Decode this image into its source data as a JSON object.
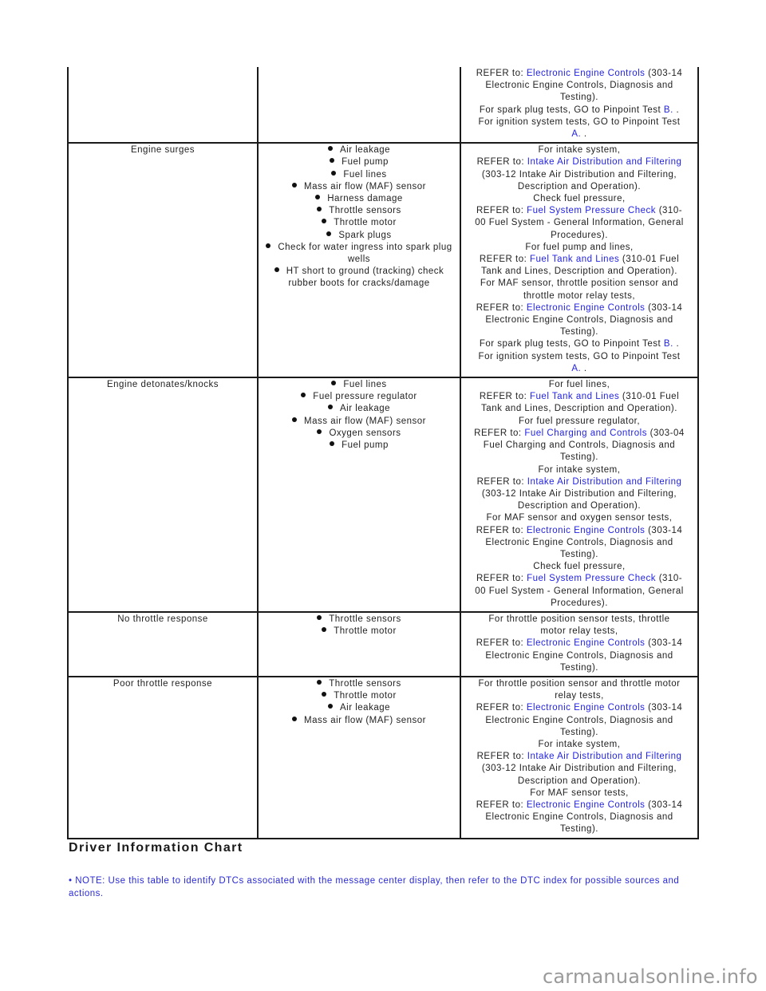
{
  "table": {
    "rows": [
      {
        "symptom": "",
        "causes": [],
        "actions": [
          {
            "segments": [
              {
                "t": "REFER to: "
              },
              {
                "t": "Electronic Engine Controls",
                "link": true
              },
              {
                "t": " (303-14"
              }
            ]
          },
          {
            "segments": [
              {
                "t": "Electronic Engine Controls, Diagnosis and"
              }
            ]
          },
          {
            "segments": [
              {
                "t": "Testing)."
              }
            ]
          },
          {
            "segments": [
              {
                "t": "For spark plug tests, GO to Pinpoint Test "
              },
              {
                "t": "B.",
                "link": true
              },
              {
                "t": " ."
              }
            ]
          },
          {
            "segments": [
              {
                "t": "For ignition system tests, GO to Pinpoint Test"
              }
            ]
          },
          {
            "segments": [
              {
                "t": "A.",
                "link": true
              },
              {
                "t": " ."
              }
            ]
          }
        ]
      },
      {
        "symptom": "Engine surges",
        "causes": [
          "Air leakage",
          "Fuel pump",
          "Fuel lines",
          "Mass air flow (MAF) sensor",
          "Harness damage",
          "Throttle sensors",
          "Throttle motor",
          "Spark plugs",
          "Check for water ingress into spark plug wells",
          "HT short to ground (tracking) check rubber boots for cracks/damage"
        ],
        "actions": [
          {
            "segments": [
              {
                "t": "For intake system,"
              }
            ]
          },
          {
            "segments": [
              {
                "t": "REFER to: "
              },
              {
                "t": "Intake Air Distribution and Filtering",
                "link": true
              }
            ]
          },
          {
            "segments": [
              {
                "t": "(303-12 Intake Air Distribution and Filtering,"
              }
            ]
          },
          {
            "segments": [
              {
                "t": "Description and Operation)."
              }
            ]
          },
          {
            "segments": [
              {
                "t": "Check fuel pressure,"
              }
            ]
          },
          {
            "segments": [
              {
                "t": "REFER to: "
              },
              {
                "t": "Fuel System Pressure Check",
                "link": true
              },
              {
                "t": " (310-"
              }
            ]
          },
          {
            "segments": [
              {
                "t": "00 Fuel System - General Information, General"
              }
            ]
          },
          {
            "segments": [
              {
                "t": "Procedures)."
              }
            ]
          },
          {
            "segments": [
              {
                "t": "For fuel pump and lines,"
              }
            ]
          },
          {
            "segments": [
              {
                "t": "REFER to: "
              },
              {
                "t": "Fuel Tank and Lines",
                "link": true
              },
              {
                "t": " (310-01 Fuel"
              }
            ]
          },
          {
            "segments": [
              {
                "t": "Tank and Lines, Description and Operation)."
              }
            ]
          },
          {
            "segments": [
              {
                "t": "For MAF sensor, throttle position sensor and"
              }
            ]
          },
          {
            "segments": [
              {
                "t": "throttle motor relay tests,"
              }
            ]
          },
          {
            "segments": [
              {
                "t": "REFER to: "
              },
              {
                "t": "Electronic Engine Controls",
                "link": true
              },
              {
                "t": " (303-14"
              }
            ]
          },
          {
            "segments": [
              {
                "t": "Electronic Engine Controls, Diagnosis and"
              }
            ]
          },
          {
            "segments": [
              {
                "t": "Testing)."
              }
            ]
          },
          {
            "segments": [
              {
                "t": "For spark plug tests, GO to Pinpoint Test "
              },
              {
                "t": "B.",
                "link": true
              },
              {
                "t": " ."
              }
            ]
          },
          {
            "segments": [
              {
                "t": "For ignition system tests, GO to Pinpoint Test"
              }
            ]
          },
          {
            "segments": [
              {
                "t": "A.",
                "link": true
              },
              {
                "t": " ."
              }
            ]
          }
        ]
      },
      {
        "symptom": "Engine detonates/knocks",
        "causes": [
          "Fuel lines",
          "Fuel pressure regulator",
          "Air leakage",
          "Mass air flow (MAF) sensor",
          "Oxygen sensors",
          "Fuel pump"
        ],
        "actions": [
          {
            "segments": [
              {
                "t": "For fuel lines,"
              }
            ]
          },
          {
            "segments": [
              {
                "t": "REFER to: "
              },
              {
                "t": "Fuel Tank and Lines",
                "link": true
              },
              {
                "t": " (310-01 Fuel"
              }
            ]
          },
          {
            "segments": [
              {
                "t": "Tank and Lines, Description and Operation)."
              }
            ]
          },
          {
            "segments": [
              {
                "t": "For fuel pressure regulator,"
              }
            ]
          },
          {
            "segments": [
              {
                "t": "REFER to: "
              },
              {
                "t": "Fuel Charging and Controls",
                "link": true
              },
              {
                "t": " (303-04"
              }
            ]
          },
          {
            "segments": [
              {
                "t": "Fuel Charging and Controls, Diagnosis and"
              }
            ]
          },
          {
            "segments": [
              {
                "t": "Testing)."
              }
            ]
          },
          {
            "segments": [
              {
                "t": "For intake system,"
              }
            ]
          },
          {
            "segments": [
              {
                "t": "REFER to: "
              },
              {
                "t": "Intake Air Distribution and Filtering",
                "link": true
              }
            ]
          },
          {
            "segments": [
              {
                "t": "(303-12 Intake Air Distribution and Filtering,"
              }
            ]
          },
          {
            "segments": [
              {
                "t": "Description and Operation)."
              }
            ]
          },
          {
            "segments": [
              {
                "t": "For MAF sensor and oxygen sensor tests,"
              }
            ]
          },
          {
            "segments": [
              {
                "t": "REFER to: "
              },
              {
                "t": "Electronic Engine Controls",
                "link": true
              },
              {
                "t": " (303-14"
              }
            ]
          },
          {
            "segments": [
              {
                "t": "Electronic Engine Controls, Diagnosis and"
              }
            ]
          },
          {
            "segments": [
              {
                "t": "Testing)."
              }
            ]
          },
          {
            "segments": [
              {
                "t": "Check fuel pressure,"
              }
            ]
          },
          {
            "segments": [
              {
                "t": "REFER to: "
              },
              {
                "t": "Fuel System Pressure Check",
                "link": true
              },
              {
                "t": " (310-"
              }
            ]
          },
          {
            "segments": [
              {
                "t": "00 Fuel System - General Information, General"
              }
            ]
          },
          {
            "segments": [
              {
                "t": "Procedures)."
              }
            ]
          }
        ]
      },
      {
        "symptom": "No throttle response",
        "causes": [
          "Throttle sensors",
          "Throttle motor"
        ],
        "actions": [
          {
            "segments": [
              {
                "t": "For throttle position sensor tests, throttle"
              }
            ]
          },
          {
            "segments": [
              {
                "t": "motor relay tests,"
              }
            ]
          },
          {
            "segments": [
              {
                "t": "REFER to: "
              },
              {
                "t": "Electronic Engine Controls",
                "link": true
              },
              {
                "t": " (303-14"
              }
            ]
          },
          {
            "segments": [
              {
                "t": "Electronic Engine Controls, Diagnosis and"
              }
            ]
          },
          {
            "segments": [
              {
                "t": "Testing)."
              }
            ]
          }
        ]
      },
      {
        "symptom": "Poor throttle response",
        "causes": [
          "Throttle sensors",
          "Throttle motor",
          "Air leakage",
          "Mass air flow (MAF) sensor"
        ],
        "actions": [
          {
            "segments": [
              {
                "t": "For throttle position sensor and throttle motor"
              }
            ]
          },
          {
            "segments": [
              {
                "t": "relay tests,"
              }
            ]
          },
          {
            "segments": [
              {
                "t": "REFER to: "
              },
              {
                "t": "Electronic Engine Controls",
                "link": true
              },
              {
                "t": " (303-14"
              }
            ]
          },
          {
            "segments": [
              {
                "t": "Electronic Engine Controls, Diagnosis and"
              }
            ]
          },
          {
            "segments": [
              {
                "t": "Testing)."
              }
            ]
          },
          {
            "segments": [
              {
                "t": "For intake system,"
              }
            ]
          },
          {
            "segments": [
              {
                "t": "REFER to: "
              },
              {
                "t": "Intake Air Distribution and Filtering",
                "link": true
              }
            ]
          },
          {
            "segments": [
              {
                "t": "(303-12 Intake Air Distribution and Filtering,"
              }
            ]
          },
          {
            "segments": [
              {
                "t": "Description and Operation)."
              }
            ]
          },
          {
            "segments": [
              {
                "t": "For MAF sensor tests,"
              }
            ]
          },
          {
            "segments": [
              {
                "t": "REFER to: "
              },
              {
                "t": "Electronic Engine Controls",
                "link": true
              },
              {
                "t": " (303-14"
              }
            ]
          },
          {
            "segments": [
              {
                "t": "Electronic Engine Controls, Diagnosis and"
              }
            ]
          },
          {
            "segments": [
              {
                "t": "Testing)."
              }
            ]
          }
        ]
      }
    ]
  },
  "section": {
    "heading": "Driver Information Chart",
    "note": "• NOTE: Use this table to identify DTCs associated with the message center display, then refer to the DTC index for possible sources and actions."
  },
  "watermark": "carmanualsonline.info",
  "colors": {
    "link": "#2323e6",
    "note": "#2a2ad8",
    "border": "#1a1a1a"
  }
}
